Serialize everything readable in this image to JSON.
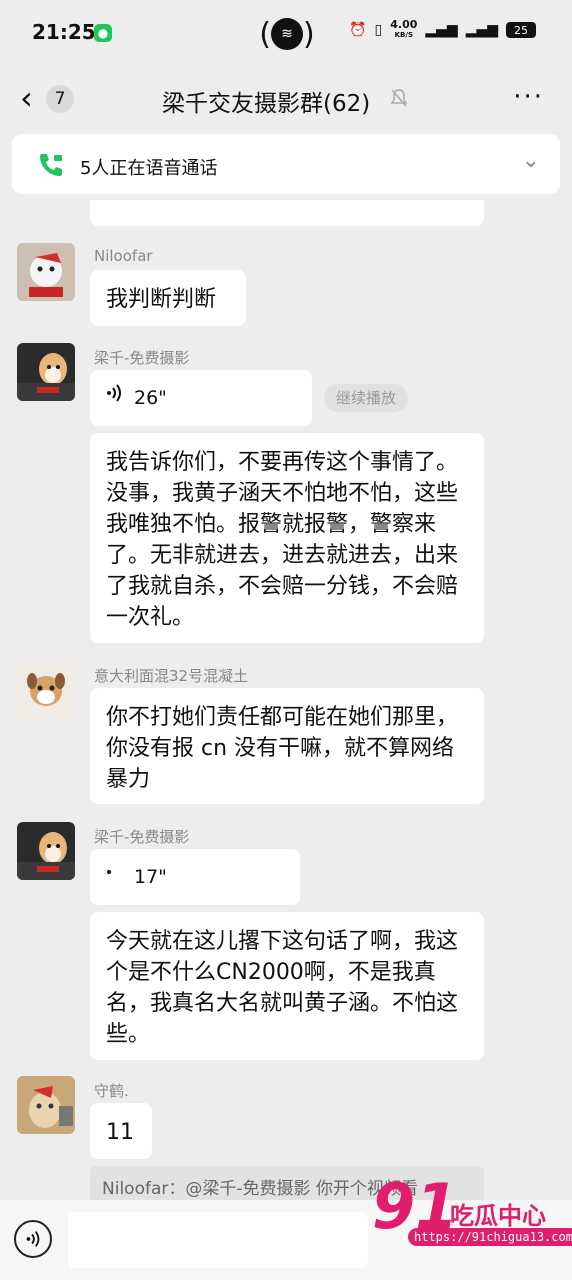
{
  "status": {
    "time": "21:25",
    "net_speed": "4.00",
    "net_unit": "KB/S",
    "battery": "25"
  },
  "header": {
    "back_badge": "7",
    "title": "梁千交友摄影群(62)"
  },
  "voice_call": {
    "label": "5人正在语音通话"
  },
  "messages": [
    {
      "sender": "Niloofar",
      "text": "我判断判断"
    },
    {
      "sender": "梁千-免费摄影",
      "voice_duration": "26\"",
      "continue_label": "继续播放",
      "text": "我告诉你们，不要再传这个事情了。没事，我黄子涵天不怕地不怕，这些我唯独不怕。报警就报警，警察来了。无非就进去，进去就进去，出来了我就自杀，不会赔一分钱，不会赔一次礼。"
    },
    {
      "sender": "意大利面混32号混凝土",
      "text": "你不打她们责任都可能在她们那里，你没有报 cn 没有干嘛，就不算网络暴力"
    },
    {
      "sender": "梁千-免费摄影",
      "voice_duration": "17\"",
      "text": "今天就在这儿撂下这句话了啊，我这个是不什么CN2000啊，不是我真名，我真名大名就叫黄子涵。不怕这些。"
    },
    {
      "sender": "守鹤.",
      "text": "11"
    }
  ],
  "quote": {
    "text": "Niloofar：@梁千-免费摄影 你开个视频看"
  },
  "watermark": {
    "number": "91",
    "text": "吃瓜中心",
    "url": "https://91chigua13.com"
  }
}
